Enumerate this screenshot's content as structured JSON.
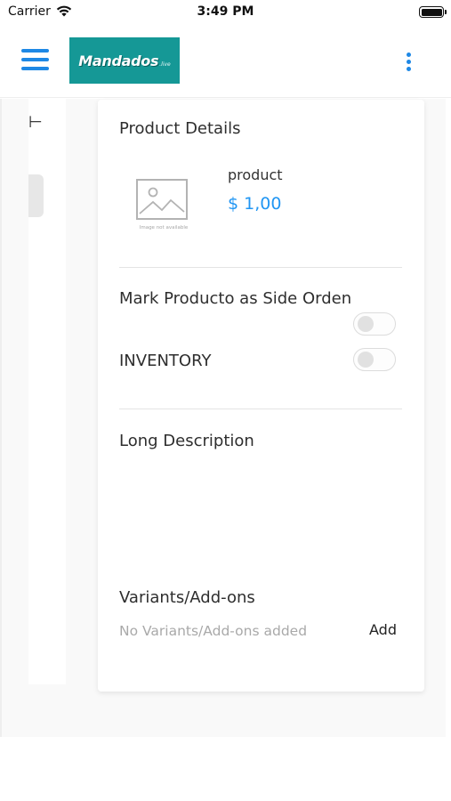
{
  "status_bar": {
    "carrier": "Carrier",
    "time": "3:49 PM",
    "battery_level": 1.0
  },
  "header": {
    "logo_text": "Mandados",
    "logo_sub": ".live",
    "menu_icon": "hamburger-menu-icon",
    "more_icon": "more-vertical-icon",
    "brand_color": "#159896",
    "accent_color": "#1e88e5"
  },
  "side_panel": {
    "glyph": "⊢"
  },
  "product_details": {
    "title": "Product Details",
    "image_caption": "Image not available",
    "name": "product",
    "price": "$ 1,00",
    "price_color": "#2196f3"
  },
  "options": {
    "side_order_label": "Mark Producto as Side Orden",
    "side_order_enabled": false,
    "inventory_label": "INVENTORY",
    "inventory_enabled": false
  },
  "long_description": {
    "title": "Long Description",
    "text": ""
  },
  "variants": {
    "title": "Variants/Add-ons",
    "empty_text": "No Variants/Add-ons added",
    "add_label": "Add"
  }
}
